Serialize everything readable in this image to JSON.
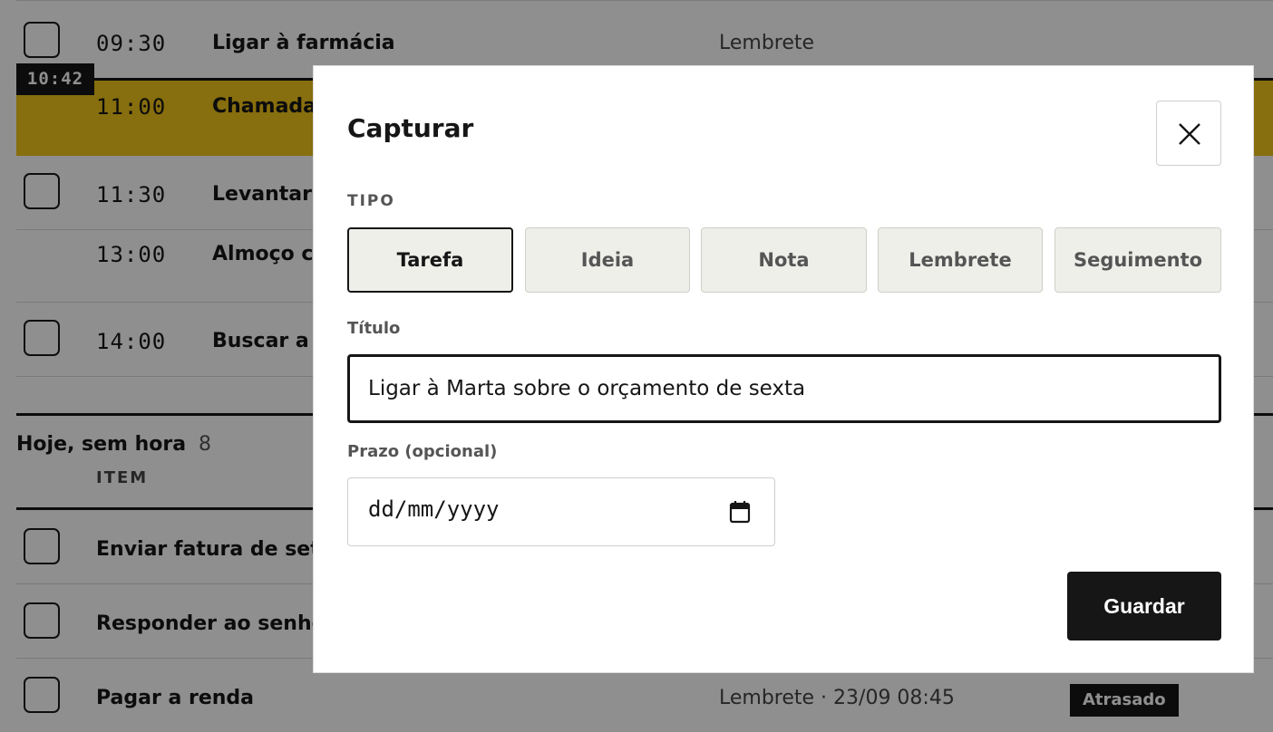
{
  "agenda": {
    "now_time": "10:42",
    "rows": [
      {
        "time": "09:30",
        "title": "Ligar à farmácia",
        "meta": "Lembrete"
      },
      {
        "time": "11:00",
        "title": "Chamada",
        "meta": ""
      },
      {
        "time": "11:30",
        "title": "Levantar",
        "meta": ""
      },
      {
        "time": "13:00",
        "title": "Almoço c",
        "meta": ""
      },
      {
        "time": "14:00",
        "title": "Buscar a",
        "meta": ""
      }
    ]
  },
  "no_time_section": {
    "title": "Hoje, sem hora",
    "count": "8",
    "column_header": "ITEM",
    "items": [
      {
        "title": "Enviar fatura de sete",
        "meta": "",
        "badge": ""
      },
      {
        "title": "Responder ao senho",
        "meta": "",
        "badge": ""
      },
      {
        "title": "Pagar a renda",
        "meta": "Lembrete · 23/09 08:45",
        "badge": "Atrasado"
      }
    ]
  },
  "modal": {
    "title": "Capturar",
    "type_label": "TIPO",
    "types": [
      "Tarefa",
      "Ideia",
      "Nota",
      "Lembrete",
      "Seguimento"
    ],
    "selected_type": "Tarefa",
    "title_label": "Título",
    "title_value": "Ligar à Marta sobre o orçamento de sexta",
    "due_label": "Prazo (opcional)",
    "due_placeholder": "dd/mm/yyyy",
    "save_label": "Guardar"
  },
  "colors": {
    "highlight": "#f0c419",
    "ink": "#161616",
    "segment_bg": "#efefea"
  }
}
